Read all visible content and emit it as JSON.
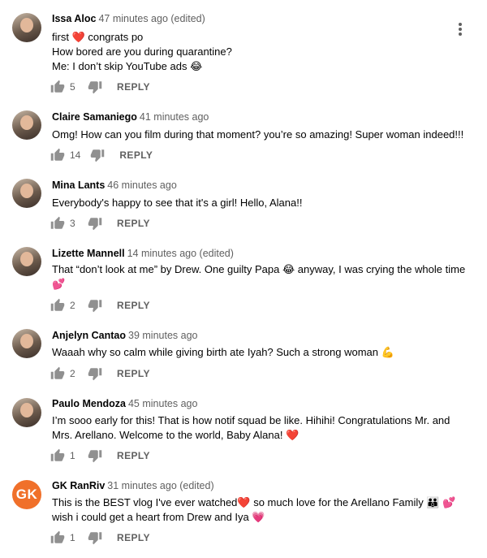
{
  "comments": [
    {
      "author": "Issa Aloc",
      "time": "47 minutes ago (edited)",
      "lines": [
        "first ❤️ congrats po",
        "How bored are you during quarantine?",
        "Me: I don’t skip YouTube ads 😂"
      ],
      "likes": "5",
      "reply": "REPLY",
      "avatar": "photo"
    },
    {
      "author": "Claire Samaniego",
      "time": "41 minutes ago",
      "lines": [
        "Omg! How can you film during that moment? you’re so amazing! Super woman indeed!!!"
      ],
      "likes": "14",
      "reply": "REPLY",
      "avatar": "photo"
    },
    {
      "author": "Mina Lants",
      "time": "46 minutes ago",
      "lines": [
        "Everybody's happy to see that it's a girl! Hello, Alana!!"
      ],
      "likes": "3",
      "reply": "REPLY",
      "avatar": "photo"
    },
    {
      "author": "Lizette Mannell",
      "time": "14 minutes ago (edited)",
      "lines": [
        "That “don’t look at me” by Drew. One guilty Papa 😂 anyway, I was crying the whole time",
        "💕"
      ],
      "likes": "2",
      "reply": "REPLY",
      "avatar": "photo"
    },
    {
      "author": "Anjelyn Cantao",
      "time": "39 minutes ago",
      "lines": [
        "Waaah why so calm while giving birth ate Iyah? Such a strong woman 💪"
      ],
      "likes": "2",
      "reply": "REPLY",
      "avatar": "photo"
    },
    {
      "author": "Paulo Mendoza",
      "time": "45 minutes ago",
      "lines": [
        "I’m sooo early for this! That is how notif squad be like. Hihihi! Congratulations Mr. and",
        "Mrs. Arellano. Welcome to the world, Baby Alana! ❤️"
      ],
      "likes": "1",
      "reply": "REPLY",
      "avatar": "photo"
    },
    {
      "author": "GK RanRiv",
      "time": "31 minutes ago (edited)",
      "lines": [
        "This is the BEST vlog I've ever watched❤️ so much love for the Arellano Family 👪 💕",
        "wish i could get a heart from Drew and Iya 💗"
      ],
      "likes": "1",
      "reply": "REPLY",
      "avatar": "letter",
      "initials": "GK"
    }
  ],
  "colors": {
    "accent_avatar": "#f0702a",
    "meta": "#606060",
    "text": "#030303"
  }
}
